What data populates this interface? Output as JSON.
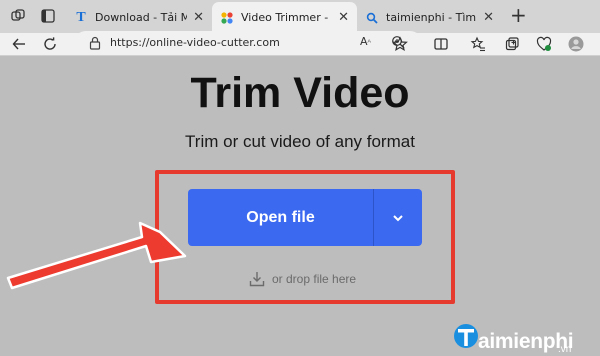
{
  "tabs": [
    {
      "label": "Download - Tải Miễn Ph",
      "favicon": "T",
      "active": false
    },
    {
      "label": "Video Trimmer - Cut Vid",
      "favicon": "dots",
      "active": true
    },
    {
      "label": "taimienphi - Tìm kiếm",
      "favicon": "search",
      "active": false
    }
  ],
  "address": {
    "url": "https://online-video-cutter.com"
  },
  "page": {
    "title": "Trim Video",
    "subtitle": "Trim or cut video of any format",
    "open_button": "Open file",
    "drop_text": "or drop file here"
  },
  "watermark": {
    "brand": "aimienphi",
    "suffix": ".vn"
  },
  "colors": {
    "accent": "#3b6af0",
    "highlight": "#e63a2e",
    "background": "#bdbdbd"
  }
}
